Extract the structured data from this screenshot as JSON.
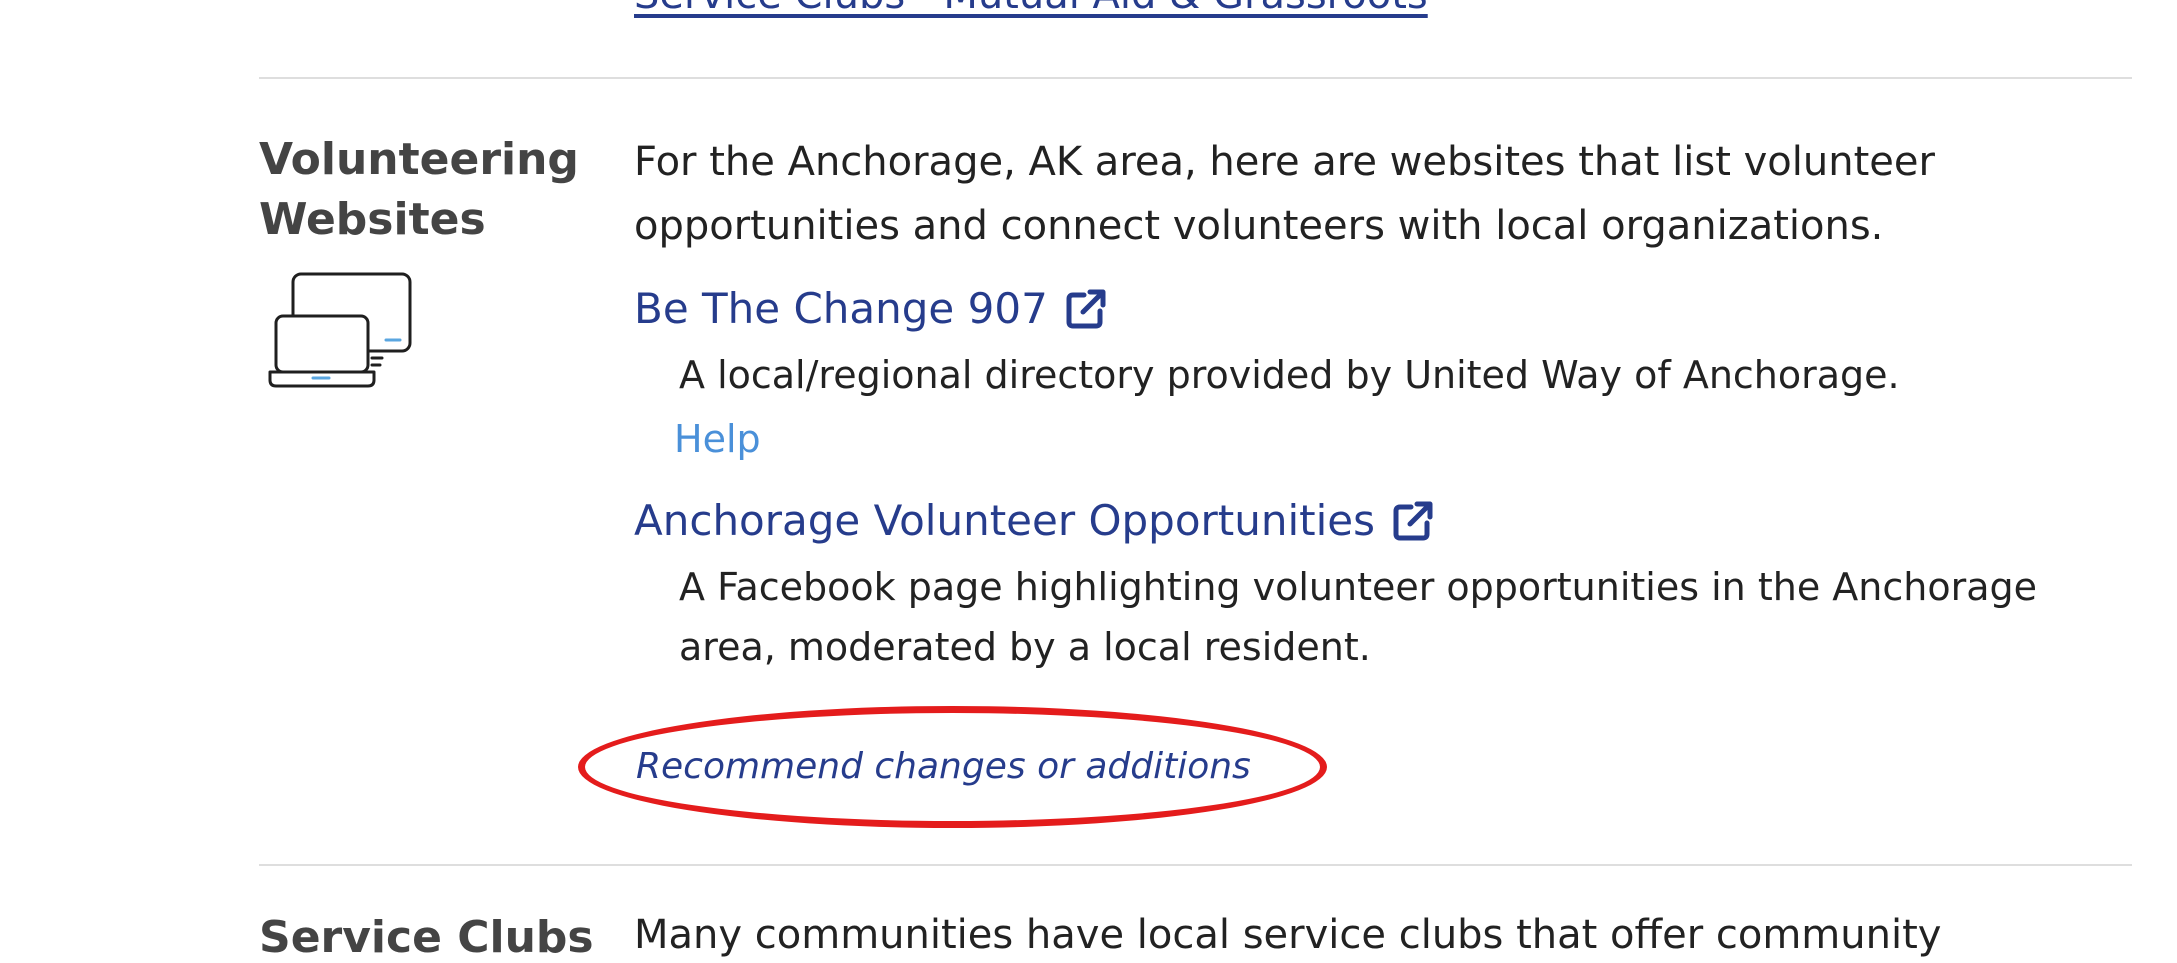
{
  "top": {
    "link_text": "Service Clubs · Mutual Aid & Grassroots"
  },
  "section": {
    "heading": "Volunteering Websites",
    "icon": "laptop-monitor-icon",
    "intro": "For the Anchorage, AK area, here are websites that list volunteer opportunities and connect volunteers with local organizations.",
    "resources": [
      {
        "name": "Be The Change 907",
        "description": "A local/regional directory provided by United Way of Anchorage.",
        "help_label": "Help"
      },
      {
        "name": "Anchorage Volunteer Opportunities",
        "description": "A Facebook page highlighting volunteer opportunities in the Anchorage area, moderated by a local resident."
      }
    ],
    "recommend_label": "Recommend changes or additions"
  },
  "next_section": {
    "heading": "Service Clubs",
    "intro": "Many communities have local service clubs that offer community"
  },
  "colors": {
    "link": "#263c8c",
    "help_link": "#4a90d9",
    "annotation": "#e41c1c",
    "divider": "#dedede"
  }
}
